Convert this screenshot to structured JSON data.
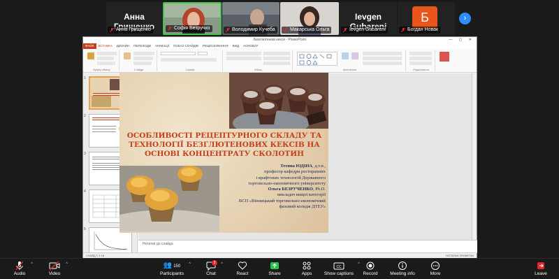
{
  "participants": [
    {
      "name": "Анна Грищенко",
      "caption": "Анна Грищенко",
      "type": "name"
    },
    {
      "name": "",
      "caption": "Софія Безручко",
      "type": "video",
      "active": true
    },
    {
      "name": "",
      "caption": "Володимир Кучеба",
      "type": "video"
    },
    {
      "name": "",
      "caption": "Макарська Ольга",
      "type": "video"
    },
    {
      "name": "Ievgen Gubareni",
      "caption": "Ievgen Gubareni",
      "type": "name"
    },
    {
      "name": "Б",
      "caption": "Богдан Новак",
      "type": "avatar"
    }
  ],
  "colors": {
    "accent": "#2d8cff",
    "active_border": "#3ec84b",
    "avatar_bg": "#e8541a",
    "slide_title": "#c7401b",
    "slide_text": "#1a2a5c",
    "leave": "#e02828"
  },
  "ppt": {
    "window_title": "Безглютенові кекси - PowerPoint",
    "tabs": [
      "ФАЙЛ",
      "ВСТАВКА",
      "ДИЗАЙН",
      "ПЕРЕХОДИ",
      "АНІМАЦІЇ",
      "ПОКАЗ СЛАЙДІВ",
      "РЕЦЕНЗУВАННЯ",
      "ВИД",
      "ACROBAT"
    ],
    "selected_tab": "ВСТАВКА",
    "ribbon_groups": [
      "Буфер обміну",
      "Слайди",
      "Шрифт",
      "Абзац",
      "Креслення",
      "Редагування"
    ],
    "thumb_numbers": [
      "1",
      "2",
      "3",
      "4",
      "5"
    ],
    "notes_placeholder": "Нотатки до слайда",
    "status_left": "СЛАЙД 1 З 18",
    "status_right": "НОТАТКИ   ПРИМІТКИ"
  },
  "slide": {
    "title": "ОСОБЛИВОСТІ РЕЦЕПТУРНОГО СКЛАДУ ТА ТЕХНОЛОГІЇ БЕЗГЛЮТЕНОВИХ КЕКСІВ НА ОСНОВІ КОНЦЕНТРАТУ СКОЛОТИН",
    "author1_name": "Тетяна ЮДІНА",
    "author1_degree": ", д.т.н.,",
    "author1_pos1": "професор кафедри ресторанних",
    "author1_pos2": "і крафтових технологій Державного",
    "author1_pos3": "торговельно-економічного університету",
    "author2_name": "Ольга БЕЗРУЧЕНКО",
    "author2_degree": ", Ph.D.",
    "author2_pos1": "викладач вищої категорії",
    "author2_pos2": "ВСП «Вінницький торговельно-економічний",
    "author2_pos3": "фаховий коледж ДТЕУ»"
  },
  "controls": {
    "audio": "Audio",
    "video": "Video",
    "participants": "Participants",
    "participants_count": "150",
    "chat": "Chat",
    "chat_badge": "3",
    "react": "React",
    "share": "Share",
    "apps": "Apps",
    "captions": "Show captions",
    "record": "Record",
    "meeting_info": "Meeting info",
    "more": "More",
    "leave": "Leave"
  }
}
